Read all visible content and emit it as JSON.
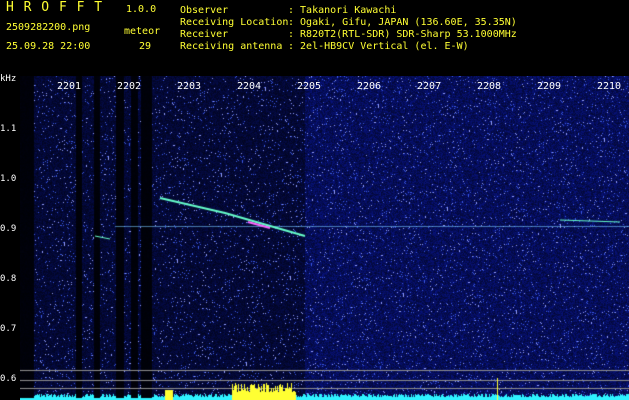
{
  "app": {
    "title": "H R O F F T",
    "version": "1.0.0",
    "filename": "2509282200.png",
    "datetime": "25.09.28 22:00",
    "meteor_label": "meteor",
    "meteor_count": "29"
  },
  "info": {
    "labels": [
      "Observer",
      "Receiving Location",
      "Receiver",
      "Receiving antenna"
    ],
    "values": [
      ": Takanori Kawachi",
      ": Ogaki, Gifu, JAPAN (136.60E, 35.35N)",
      ": R820T2(RTL-SDR) SDR-Sharp 53.1000MHz",
      ": 2el-HB9CV Vertical (el. E-W)"
    ]
  },
  "axis": {
    "unit": "kHz",
    "y_ticks": [
      "1.1",
      "1.0",
      "0.9",
      "0.8",
      "0.7",
      "0.6"
    ],
    "x_ticks": [
      "2201",
      "2202",
      "2203",
      "2204",
      "2205",
      "2206",
      "2207",
      "2208",
      "2209",
      "2210"
    ]
  },
  "colors": {
    "background": "#000000",
    "title": "#ffff33",
    "info_text": "#2ff2ff",
    "tick_text": "#ffffff",
    "noise_dark": "#0a0a50",
    "noise_mid": "#1a2a9a",
    "echo": "#66ffcc",
    "activity_bar": "#2ff2ff",
    "activity_highlight": "#ffff33"
  }
}
